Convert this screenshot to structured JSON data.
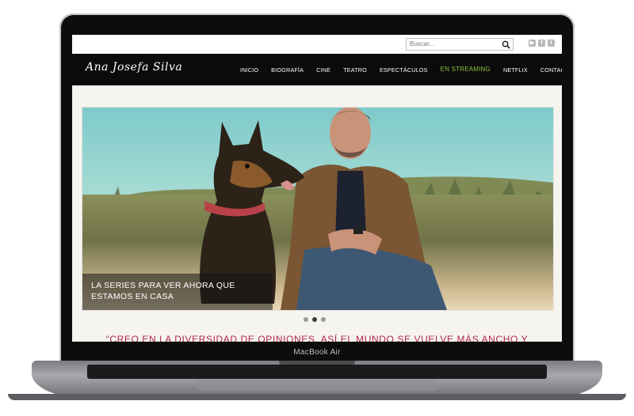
{
  "device": {
    "model_label": "MacBook Air"
  },
  "site": {
    "search": {
      "placeholder": "Buscar..."
    },
    "social": [
      "youtube-icon",
      "facebook-icon",
      "twitter-icon"
    ],
    "logo_text": "Ana Josefa Silva",
    "nav": [
      {
        "label": "INICIO"
      },
      {
        "label": "BIOGRAFÍA"
      },
      {
        "label": "CINE"
      },
      {
        "label": "TEATRO"
      },
      {
        "label": "ESPECTÁCULOS"
      },
      {
        "label": "EN STREAMING",
        "active": true
      },
      {
        "label": "NETFLIX"
      },
      {
        "label": "CONTACTO"
      }
    ],
    "slider": {
      "caption_line1": "LA SERIES PARA VER AHORA QUE",
      "caption_line2": "ESTAMOS EN CASA",
      "slides": 3,
      "active_slide": 2
    },
    "quote": "“CREO EN LA DIVERSIDAD DE OPINIONES, ASÍ EL MUNDO SE VUELVE MÁS ANCHO Y"
  },
  "colors": {
    "nav_bg": "#0b0b0b",
    "active_nav": "#8cc63f",
    "quote": "#b0254d"
  }
}
